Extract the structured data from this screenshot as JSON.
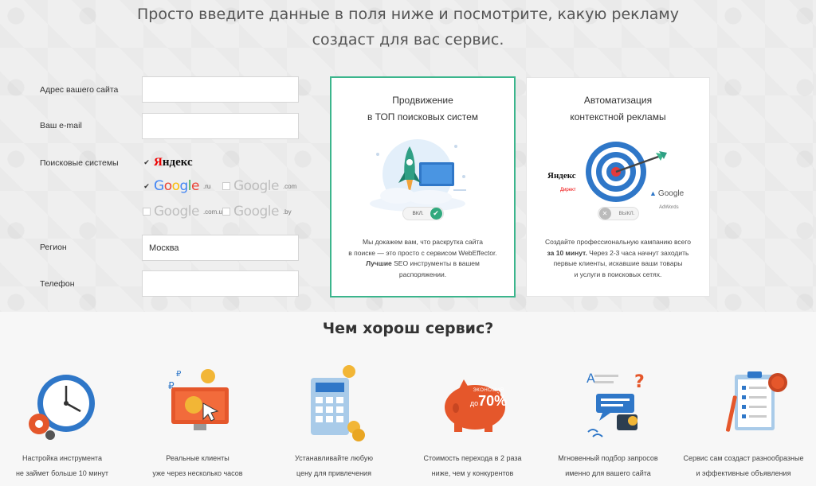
{
  "headline": {
    "line1": "Просто введите данные в поля ниже и посмотрите, какую рекламу",
    "line2": "создаст для вас сервис."
  },
  "form": {
    "site_label": "Адрес вашего сайта",
    "site_value": "",
    "email_label": "Ваш e-mail",
    "email_value": "",
    "search_label": "Поисковые системы",
    "region_label": "Регион",
    "region_value": "Москва",
    "phone_label": "Телефон",
    "phone_value": ""
  },
  "search_engines": {
    "yandex": {
      "name": "Яндекс",
      "checked": true
    },
    "google_ru": {
      "name": "Google",
      "suffix": ".ru",
      "checked": true
    },
    "google_com": {
      "name": "Google",
      "suffix": ".com",
      "checked": false
    },
    "google_com_ua": {
      "name": "Google",
      "suffix": ".com.ua",
      "checked": false
    },
    "google_by": {
      "name": "Google",
      "suffix": ".by",
      "checked": false
    }
  },
  "card_seo": {
    "title_line1": "Продвижение",
    "title_line2": "в ТОП поисковых систем",
    "toggle_label": "ВКЛ.",
    "toggle_icon": "✔",
    "desc_line1": "Мы докажем вам, что раскрутка сайта",
    "desc_line2": "в поиске — это просто с сервисом WebEffector.",
    "desc_bold": "Лучшие",
    "desc_line3_rest": " SEO инструменты в вашем",
    "desc_line4": "распоряжении.",
    "accent": "#3bb58c"
  },
  "card_ppc": {
    "title_line1": "Автоматизация",
    "title_line2": "контекстной рекламы",
    "toggle_label": "ВЫКЛ.",
    "toggle_icon": "✕",
    "logo_yandex": "Яндекс",
    "logo_yandex_sub": "Директ",
    "logo_google": "Google",
    "logo_google_sub": "AdWords",
    "desc_line1": "Создайте профессиональную кампанию всего",
    "desc_bold": "за 10 минут.",
    "desc_line2_rest": " Через 2-3 часа начнут заходить",
    "desc_line3": "первые клиенты, искавшие ваши товары",
    "desc_line4": "и услуги в поисковых сетях."
  },
  "section": {
    "title": "Чем хорош сервис?"
  },
  "features": [
    {
      "icon": "clock-gears-icon",
      "line1": "Настройка инструмента",
      "line2": "не займет больше 10 минут"
    },
    {
      "icon": "monitor-coins-icon",
      "line1": "Реальные клиенты",
      "line2": "уже через несколько часов"
    },
    {
      "icon": "calculator-coins-icon",
      "line1": "Устанавливайте любую",
      "line2": "цену для привлечения"
    },
    {
      "icon": "piggy-bank-icon",
      "line1": "Стоимость перехода в 2 раза",
      "line2": "ниже, чем у конкурентов",
      "badge_top": "ЭКОНОМИЯ",
      "badge_prefix": "до",
      "badge_value": "70%"
    },
    {
      "icon": "chat-bubbles-icon",
      "line1": "Мгновенный подбор запросов",
      "line2": "именно для вашего сайта"
    },
    {
      "icon": "clipboard-checklist-icon",
      "line1": "Сервис сам создаст разнообразные",
      "line2": "и эффективные объявления"
    }
  ]
}
